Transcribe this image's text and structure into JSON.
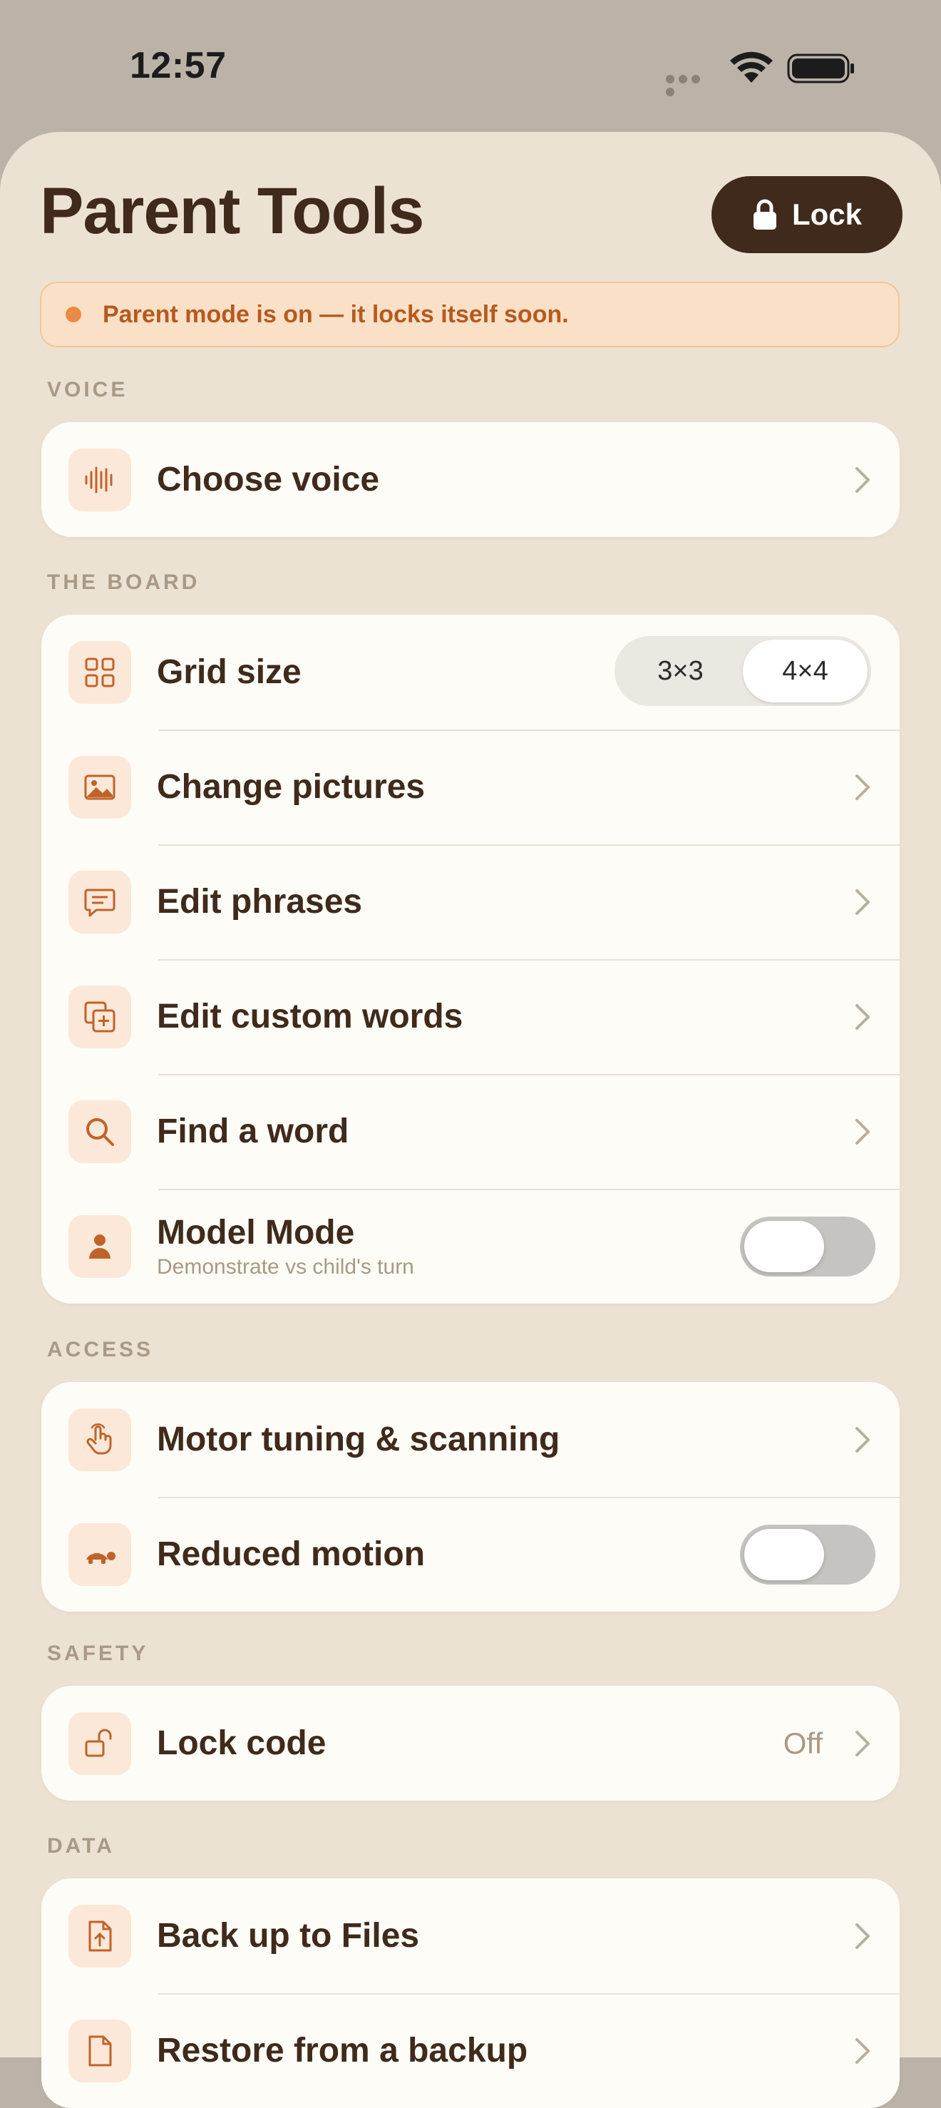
{
  "status_bar": {
    "time": "12:57"
  },
  "header": {
    "title": "Parent Tools",
    "lock_label": "Lock"
  },
  "banner": {
    "text": "Parent mode is on — it locks itself soon."
  },
  "sections": {
    "voice": {
      "label": "VOICE",
      "items": [
        {
          "label": "Choose voice",
          "icon": "waveform-icon"
        }
      ]
    },
    "board": {
      "label": "THE BOARD",
      "grid_size": {
        "label": "Grid size",
        "options": [
          "3×3",
          "4×4"
        ],
        "selected": "4×4"
      },
      "items": [
        {
          "label": "Change pictures",
          "icon": "photo-icon"
        },
        {
          "label": "Edit phrases",
          "icon": "speech-bubble-icon"
        },
        {
          "label": "Edit custom words",
          "icon": "add-square-icon"
        },
        {
          "label": "Find a word",
          "icon": "search-icon"
        }
      ],
      "model_mode": {
        "label": "Model Mode",
        "sublabel": "Demonstrate vs child's turn",
        "on": false
      }
    },
    "access": {
      "label": "ACCESS",
      "items": [
        {
          "label": "Motor tuning & scanning",
          "icon": "hand-tap-icon"
        }
      ],
      "reduced_motion": {
        "label": "Reduced motion",
        "on": false,
        "icon": "turtle-icon"
      }
    },
    "safety": {
      "label": "SAFETY",
      "lock_code": {
        "label": "Lock code",
        "value": "Off",
        "icon": "unlock-icon"
      }
    },
    "data": {
      "label": "DATA",
      "items": [
        {
          "label": "Back up to Files",
          "icon": "file-upload-icon"
        },
        {
          "label": "Restore from a backup",
          "icon": "file-download-icon"
        }
      ]
    }
  },
  "colors": {
    "accent": "#c0632a",
    "text_primary": "#3f2a1c",
    "text_secondary": "#a99985",
    "background": "#ece2d3",
    "card": "#fefcf6",
    "icon_tile": "#fce8d8",
    "banner_bg": "#fbe0c8",
    "banner_text": "#b55a1e"
  }
}
